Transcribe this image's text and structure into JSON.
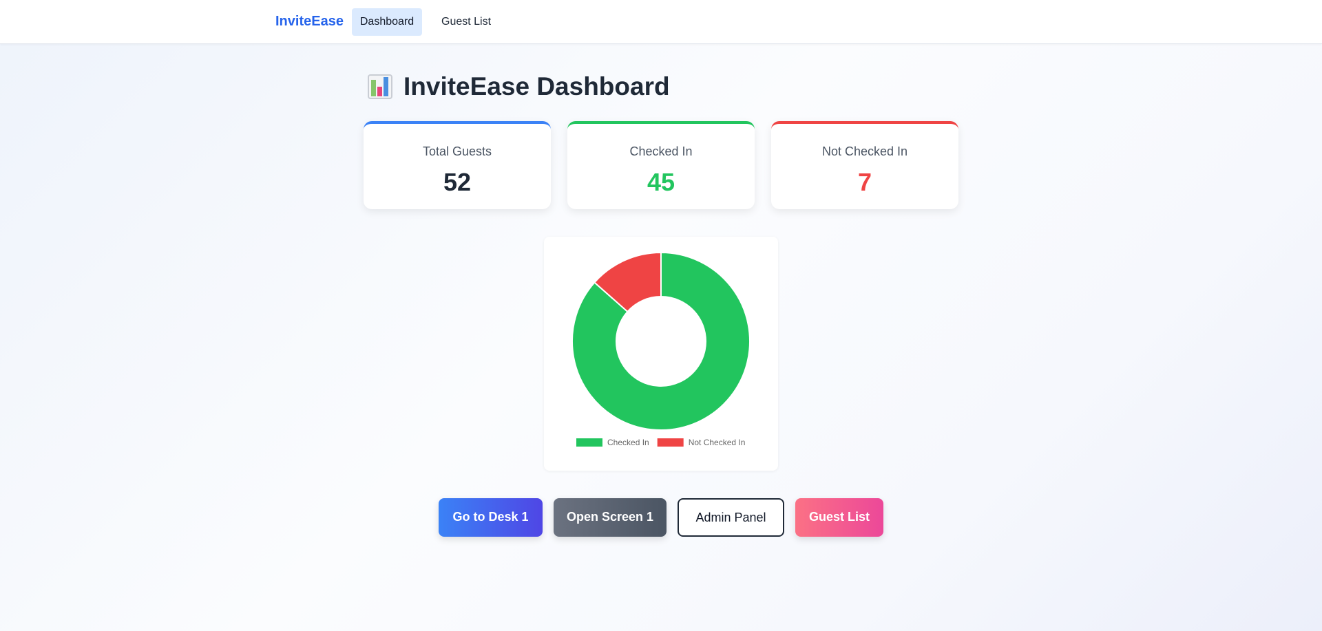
{
  "navbar": {
    "brand": "InviteEase",
    "links": [
      {
        "label": "Dashboard",
        "active": true
      },
      {
        "label": "Guest List",
        "active": false
      }
    ]
  },
  "page": {
    "title": "InviteEase Dashboard",
    "title_icon": "bar-chart-emoji"
  },
  "stats": [
    {
      "label": "Total Guests",
      "value": "52",
      "accent": "#3b82f6"
    },
    {
      "label": "Checked In",
      "value": "45",
      "accent": "#22c55e"
    },
    {
      "label": "Not Checked In",
      "value": "7",
      "accent": "#ef4444"
    }
  ],
  "chart_data": {
    "type": "pie",
    "variant": "doughnut",
    "categories": [
      "Checked In",
      "Not Checked In"
    ],
    "values": [
      45,
      7
    ],
    "colors": [
      "#22c55e",
      "#ef4444"
    ],
    "title": "",
    "legend": "bottom"
  },
  "actions": [
    {
      "label": "Go to Desk 1"
    },
    {
      "label": "Open Screen 1"
    },
    {
      "label": "Admin Panel"
    },
    {
      "label": "Guest List"
    }
  ]
}
